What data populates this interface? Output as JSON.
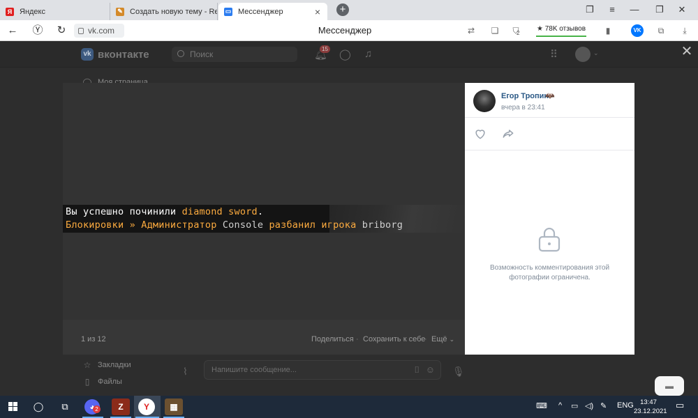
{
  "browser": {
    "tabs": [
      {
        "title": "Яндекс",
        "favicon": "yandex-icon",
        "active": false
      },
      {
        "title": "Создать новую тему - Rea",
        "favicon": "forum-icon",
        "active": false
      },
      {
        "title": "Мессенджер",
        "favicon": "messenger-icon",
        "active": true
      }
    ],
    "address": "vk.com",
    "page_title": "Мессенджер",
    "reviews_label": "78K отзывов",
    "tab_badge": "2"
  },
  "vk": {
    "logo_text": "вконтакте",
    "search_placeholder": "Поиск",
    "notifications_count": "15",
    "sidebar_partial": "Моя страница",
    "sidebar": [
      {
        "label": "Закладки",
        "icon": "star-icon"
      },
      {
        "label": "Файлы",
        "icon": "file-icon"
      }
    ],
    "message_placeholder": "Напишите сообщение..."
  },
  "viewer": {
    "chat_line1": [
      {
        "text": "Вы успешно починили ",
        "color": "white"
      },
      {
        "text": "diamond sword",
        "color": "gold"
      },
      {
        "text": ".",
        "color": "white"
      }
    ],
    "chat_line2": [
      {
        "text": "Блокировки » Администратор ",
        "color": "gold"
      },
      {
        "text": "Console ",
        "color": "grey"
      },
      {
        "text": "разбанил игрока ",
        "color": "gold"
      },
      {
        "text": "briborg",
        "color": "grey"
      }
    ],
    "counter": "1 из 12",
    "share_label": "Поделиться",
    "save_label": "Сохранить к себе",
    "more_label": "Ещё",
    "separator": "·"
  },
  "post": {
    "author": "Егор Тропин",
    "author_emoji": "🦇",
    "time": "вчера в 23:41",
    "restriction": "Возможность комментирования этой фотографии ограничена."
  },
  "taskbar": {
    "discord_badge": "2",
    "lang": "ENG",
    "time": "13:47",
    "date": "23.12.2021"
  },
  "colors": {
    "vk_link": "#2a5885",
    "minecraft_gold": "#fcab3f",
    "muted": "#818c99",
    "taskbar": "#1e2a3a"
  }
}
